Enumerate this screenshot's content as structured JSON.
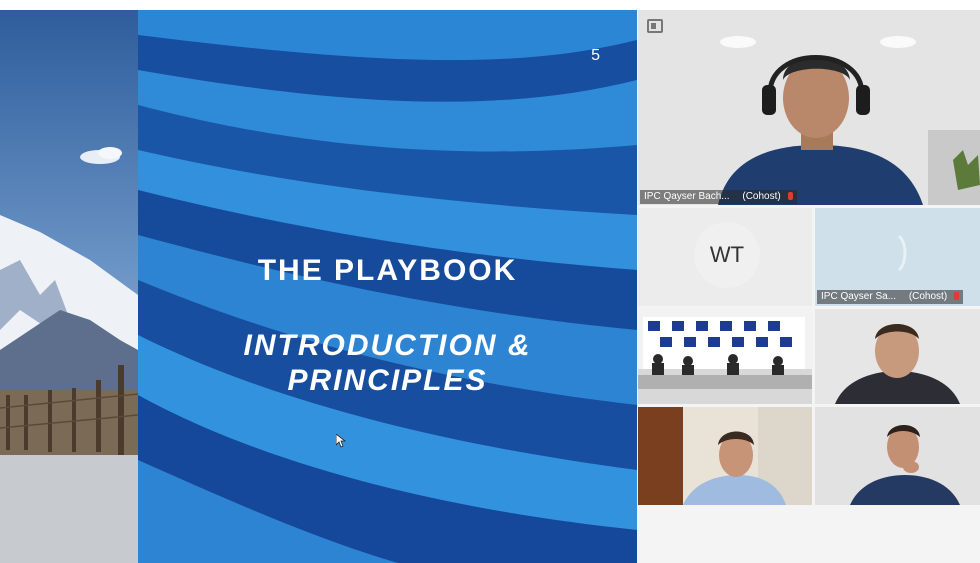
{
  "slide": {
    "page_number": "5",
    "title": "THE PLAYBOOK",
    "subtitle_line1": "INTRODUCTION &",
    "subtitle_line2": "PRINCIPLES"
  },
  "participants": [
    {
      "name": "IPC Qayser Bach...",
      "role": "(Cohost)"
    },
    {
      "initials": "WT"
    },
    {
      "name": "IPC Qayser Sa...",
      "role": "(Cohost)"
    }
  ],
  "colors": {
    "slide_light_blue": "#2f86d4",
    "slide_dark_blue": "#174ea0",
    "mic_muted": "#e03b2f"
  },
  "icons": [
    "gallery-view-icon",
    "mic-muted-icon",
    "chevron-right-icon",
    "mouse-cursor-icon"
  ]
}
